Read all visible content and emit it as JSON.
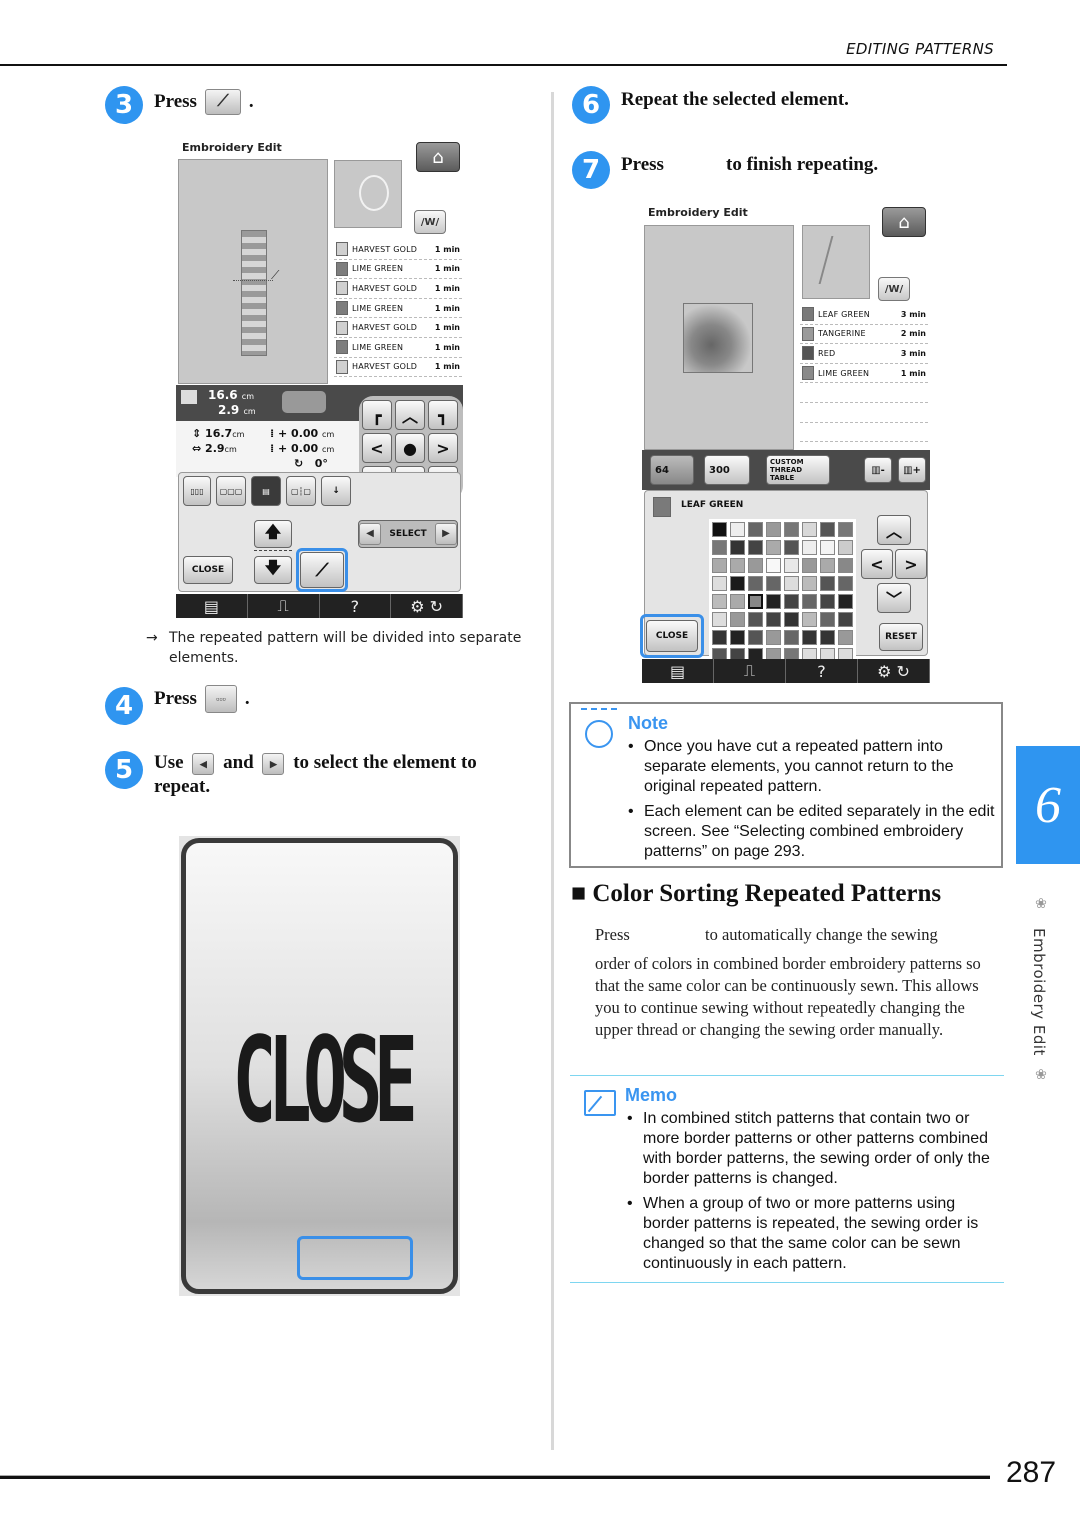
{
  "header": {
    "section_title": "EDITING PATTERNS"
  },
  "footer": {
    "page_number": "287"
  },
  "chapter_tab": {
    "number": "6",
    "label": "Embroidery Edit"
  },
  "left_column": {
    "step3": {
      "number": "3",
      "press": "Press",
      "icon": "knife-cut-icon",
      "period": "."
    },
    "screen1": {
      "title": "Embroidery Edit",
      "home_icon": "home-icon",
      "thread_list": [
        {
          "name": "HARVEST GOLD",
          "time": "1 min",
          "color": "#d0d0d0"
        },
        {
          "name": "LIME GREEN",
          "time": "1 min",
          "color": "#7e7e7e"
        },
        {
          "name": "HARVEST GOLD",
          "time": "1 min",
          "color": "#d0d0d0"
        },
        {
          "name": "LIME GREEN",
          "time": "1 min",
          "color": "#7e7e7e"
        },
        {
          "name": "HARVEST GOLD",
          "time": "1 min",
          "color": "#d0d0d0"
        },
        {
          "name": "LIME GREEN",
          "time": "1 min",
          "color": "#7e7e7e"
        },
        {
          "name": "HARVEST GOLD",
          "time": "1 min",
          "color": "#d0d0d0"
        }
      ],
      "size_w": "16.6",
      "size_h": "2.9",
      "unit": "cm",
      "dim_h": "16.7",
      "dim_w": "2.9",
      "offset_1": "+ 0.00",
      "offset_2": "+ 0.00",
      "rotation": "0°",
      "select_label": "SELECT",
      "close_label": "CLOSE",
      "help_label": "?"
    },
    "result_text": "The repeated pattern will be divided into separate elements.",
    "result_arrow": "→",
    "step4": {
      "number": "4",
      "press": "Press",
      "period": "."
    },
    "step5": {
      "number": "5",
      "use": "Use",
      "and": "and",
      "rest": "to select the element to",
      "line2": "repeat."
    },
    "close_zoom": {
      "label": "CLOSE"
    }
  },
  "right_column": {
    "step6": {
      "number": "6",
      "text": "Repeat the selected element."
    },
    "step7": {
      "number": "7",
      "press": "Press",
      "rest": "to finish repeating."
    },
    "screen2": {
      "title": "Embroidery Edit",
      "thread_list": [
        {
          "name": "LEAF GREEN",
          "time": "3 min",
          "color": "#7a7a7a"
        },
        {
          "name": "TANGERINE",
          "time": "2 min",
          "color": "#9a9a9a"
        },
        {
          "name": "RED",
          "time": "3 min",
          "color": "#555555"
        },
        {
          "name": "LIME GREEN",
          "time": "1 min",
          "color": "#8a8a8a"
        },
        {
          "name": "",
          "time": "",
          "color": ""
        },
        {
          "name": "",
          "time": "",
          "color": ""
        },
        {
          "name": "",
          "time": "",
          "color": ""
        }
      ],
      "tab_64": "64",
      "tab_300": "300",
      "custom_table": "CUSTOM THREAD TABLE",
      "selected_thread": "LEAF GREEN",
      "close_label": "CLOSE",
      "reset_label": "RESET",
      "help_label": "?",
      "swatches": [
        "#111",
        "#eee",
        "#666",
        "#999",
        "#777",
        "#d8d8d8",
        "#555",
        "#777",
        "#777",
        "#333",
        "#444",
        "#aaa",
        "#555",
        "#eee",
        "#f4f4f4",
        "#ccc",
        "#aaa",
        "#aaa",
        "#999",
        "#f8f8f8",
        "#e8e8e8",
        "#999",
        "#aaa",
        "#888",
        "#ddd",
        "#1a1a1a",
        "#666",
        "#666",
        "#ddd",
        "#bbb",
        "#555",
        "#666",
        "#bbb",
        "#aaa",
        "#888",
        "#222",
        "#444",
        "#666",
        "#444",
        "#222",
        "#ddd",
        "#999",
        "#555",
        "#444",
        "#333",
        "#bbb",
        "#666",
        "#444",
        "#333",
        "#222",
        "#555",
        "#999",
        "#666",
        "#333",
        "#333",
        "#999",
        "#555",
        "#444",
        "#222",
        "#999",
        "#777",
        "#ddd",
        "#ddd",
        "#ddd"
      ],
      "selected_swatch_index": 34
    },
    "note": {
      "title": "Note",
      "items": [
        "Once you have cut a repeated pattern into separate elements, you cannot return to the original repeated pattern.",
        "Each element can be edited separately in the edit screen. See “Selecting combined embroidery patterns” on page 293."
      ]
    },
    "section": {
      "marker": "■",
      "title": "Color Sorting Repeated Patterns",
      "press": "Press",
      "line1_rest": "to automatically change the sewing",
      "body": "order of colors in combined border embroidery patterns so that the same color can be continuously sewn. This allows you to continue sewing without repeatedly changing the upper thread or changing the sewing order manually."
    },
    "memo": {
      "title": "Memo",
      "items": [
        "In combined stitch patterns that contain two or more border patterns or other patterns combined with border patterns, the sewing order of only the border patterns is changed.",
        "When a group of two or more patterns using border patterns is repeated, the sewing order is changed so that the same color can be sewn continuously in each pattern."
      ]
    }
  }
}
